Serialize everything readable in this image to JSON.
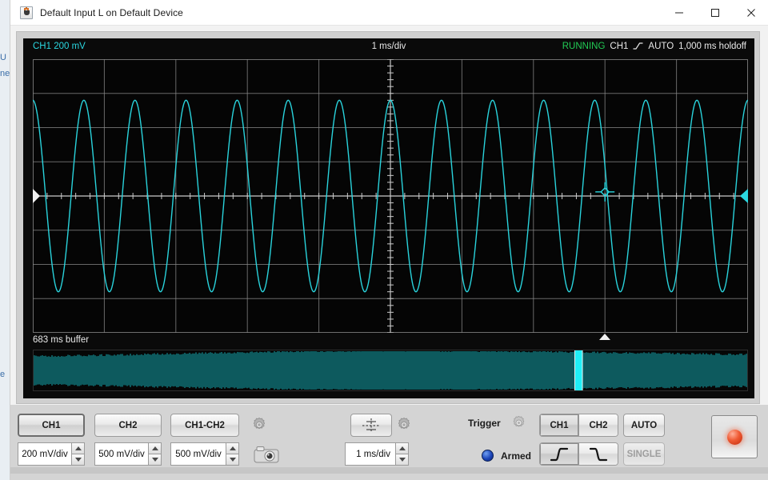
{
  "window": {
    "title": "Default Input L on Default Device",
    "app_icon": "java-coffee-icon",
    "minimize_label": "Minimize",
    "maximize_label": "Maximize",
    "close_label": "Close"
  },
  "desktop": {
    "edge_glyphs": [
      "U",
      "ne",
      "e"
    ]
  },
  "scope": {
    "channel_label": "CH1 200 mV",
    "timebase_label": "1 ms/div",
    "status": {
      "run_state": "RUNNING",
      "trigger_source": "CH1",
      "trigger_slope_icon": "rising-edge-icon",
      "trigger_mode": "AUTO",
      "holdoff": "1,000 ms holdoff"
    },
    "buffer_label": "683 ms buffer",
    "colors": {
      "trace": "#2ad7e0",
      "grid": "#8a8a8a",
      "background": "#050505",
      "running": "#22cc55",
      "buffer_fill": "#0d5a5e",
      "buffer_window": "#1ff0f7"
    },
    "markers": {
      "ch1_ground_left": "left-ground-marker",
      "ch1_ground_right": "right-ground-marker",
      "trigger_point": "trigger-crosshair-marker",
      "trigger_time": "trigger-time-marker"
    }
  },
  "chart_data": {
    "type": "line",
    "title": "CH1 200 mV",
    "xlabel": "1 ms/div",
    "ylabel": "200 mV/div",
    "series": [
      {
        "name": "CH1",
        "waveform": "sine",
        "amplitude_divs": 2.8,
        "cycles_on_screen": 14,
        "phase_deg": 90,
        "color": "#2ad7e0"
      }
    ],
    "grid": true,
    "x_divisions": 10,
    "y_divisions": 8,
    "xlim": [
      -5,
      5
    ],
    "ylim": [
      -4,
      4
    ],
    "trigger_marker": {
      "x_div": 3.0,
      "y_div": 0.12
    },
    "legend": "none"
  },
  "buffer_chart": {
    "type": "area",
    "label": "683 ms buffer",
    "window_start_pct": 75.9,
    "window_width_pct": 0.95
  },
  "controls": {
    "channels": [
      {
        "name": "ch1",
        "label": "CH1",
        "selected": true,
        "scale": "200 mV/div"
      },
      {
        "name": "ch2",
        "label": "CH2",
        "selected": false,
        "scale": "500 mV/div"
      },
      {
        "name": "ch1-ch2",
        "label": "CH1-CH2",
        "selected": false,
        "scale": "500 mV/div"
      }
    ],
    "channel_settings_icon": "gear-icon",
    "screenshot_icon": "camera-icon",
    "cursor_button_icon": "crosshair-icon",
    "timebase_settings_icon": "gear-icon",
    "timebase": "1 ms/div",
    "trigger": {
      "label": "Trigger",
      "settings_icon": "gear-icon",
      "source_options": [
        {
          "label": "CH1",
          "selected": true
        },
        {
          "label": "CH2",
          "selected": false
        }
      ],
      "mode_label": "AUTO",
      "armed_label": "Armed",
      "armed_led": "blue",
      "slope_options": [
        {
          "icon": "rising-edge-icon",
          "selected": true
        },
        {
          "icon": "falling-edge-icon",
          "selected": false
        }
      ],
      "single_label": "SINGLE",
      "single_enabled": false
    },
    "record_button": {
      "icon": "record-dot-icon",
      "label": "Record"
    }
  }
}
